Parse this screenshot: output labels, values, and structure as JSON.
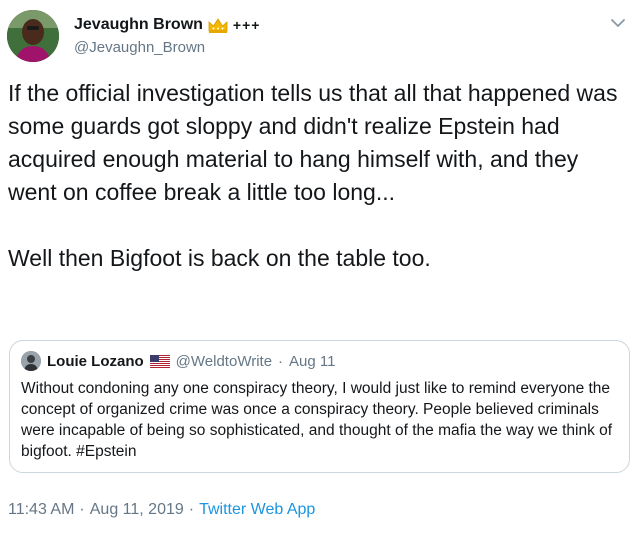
{
  "author": {
    "display_name": "Jevaughn Brown",
    "name_suffix": "+++",
    "handle": "@Jevaughn_Brown",
    "avatar": "avatar-photo",
    "name_icon": "crown-icon"
  },
  "tweet": {
    "text": "If the official investigation tells us that all that happened was some guards got sloppy and didn't realize Epstein had acquired enough material to hang himself with, and they went on coffee break a little too long...\n\nWell then Bigfoot is back on the table too."
  },
  "quoted": {
    "display_name": "Louie Lozano",
    "name_icon": "us-flag-icon",
    "handle": "@WeldtoWrite",
    "separator": "·",
    "date": "Aug 11",
    "text": "Without condoning any one conspiracy theory, I would just like to remind everyone the concept of organized crime was once a conspiracy theory. People believed criminals were incapable of being so sophisticated, and thought of the mafia the way we think of bigfoot. #Epstein"
  },
  "meta": {
    "time": "11:43 AM",
    "separator": "·",
    "date": "Aug 11, 2019",
    "source": "Twitter Web App"
  },
  "colors": {
    "text": "#14171a",
    "secondary": "#657786",
    "link": "#1b95e0",
    "border": "#ccd6dd"
  }
}
